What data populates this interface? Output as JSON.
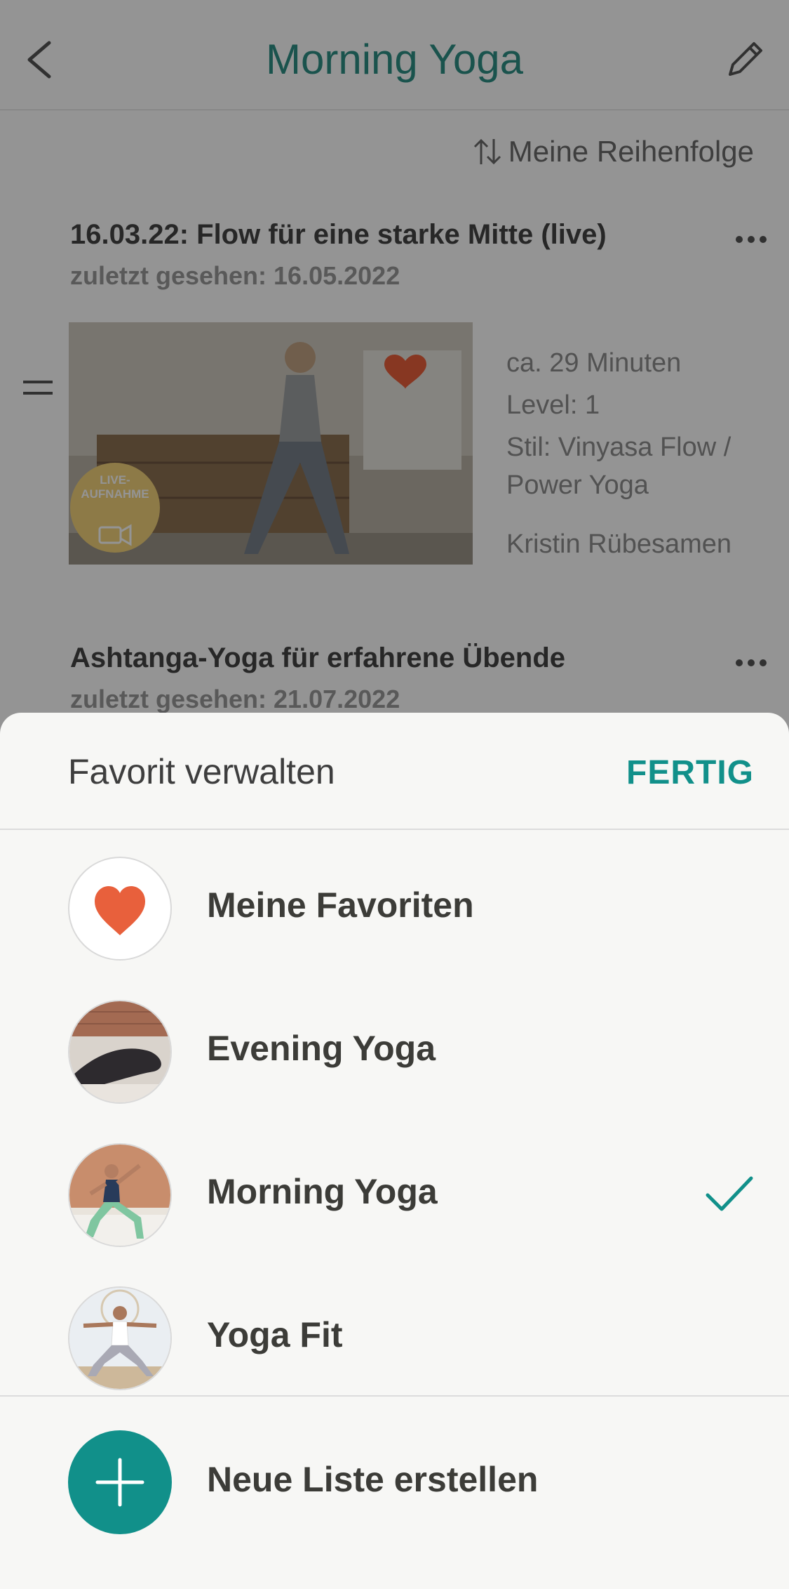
{
  "header": {
    "title": "Morning Yoga"
  },
  "sort": {
    "label": "Meine Reihenfolge"
  },
  "items": [
    {
      "title": "16.03.22: Flow für eine starke Mitte (live)",
      "last_seen": "zuletzt gesehen: 16.05.2022",
      "duration": "ca. 29 Minuten",
      "level": "Level: 1",
      "style_line1": "Stil: Vinyasa Flow /",
      "style_line2": "Power Yoga",
      "teacher": "Kristin Rübesamen",
      "badge_line1": "LIVE-",
      "badge_line2": "AUFNAHME"
    },
    {
      "title": "Ashtanga-Yoga für erfahrene Übende",
      "last_seen": "zuletzt gesehen: 21.07.2022"
    }
  ],
  "sheet": {
    "title": "Favorit verwalten",
    "done": "FERTIG",
    "lists": [
      {
        "label": "Meine Favoriten",
        "icon": "heart-icon",
        "checked": false
      },
      {
        "label": "Evening Yoga",
        "checked": false
      },
      {
        "label": "Morning Yoga",
        "checked": true
      },
      {
        "label": "Yoga Fit",
        "checked": false
      }
    ],
    "new_list": "Neue Liste erstellen"
  },
  "colors": {
    "accent": "#11908a",
    "heart": "#e8603c",
    "title": "#2d8f86"
  }
}
